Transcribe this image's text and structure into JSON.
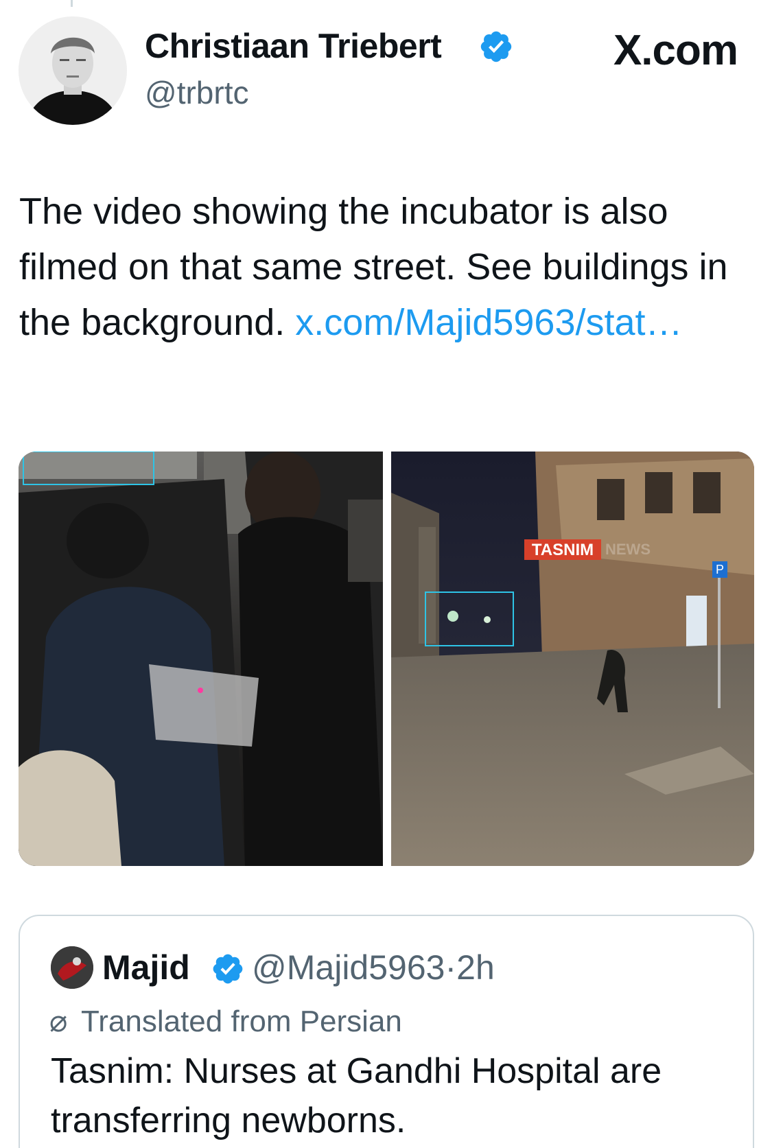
{
  "author": {
    "display_name": "Christiaan Triebert",
    "handle": "@trbrtc",
    "verified": true
  },
  "brand": "X.com",
  "tweet": {
    "text": "The video showing the incubator is also filmed on that same street. See buildings in the background. ",
    "link_text": "x.com/​Majid5963/stat…"
  },
  "media": {
    "left_image": "night-crowd-incubator",
    "right_image": "damaged-street-night",
    "watermark": "TASNIM",
    "watermark_suffix": "NEWS",
    "parking_sign": "P"
  },
  "quote": {
    "display_name": "Majid",
    "handle": "@Majid5963",
    "separator": "·",
    "time": "2h",
    "translated_label": "Translated from Persian",
    "text": "Tasnim: Nurses at Gandhi Hospital are transferring newborns."
  },
  "colors": {
    "link": "#1d9bf0",
    "verified": "#1d9bf0",
    "secondary_text": "#536471",
    "border": "#cfd9de"
  }
}
